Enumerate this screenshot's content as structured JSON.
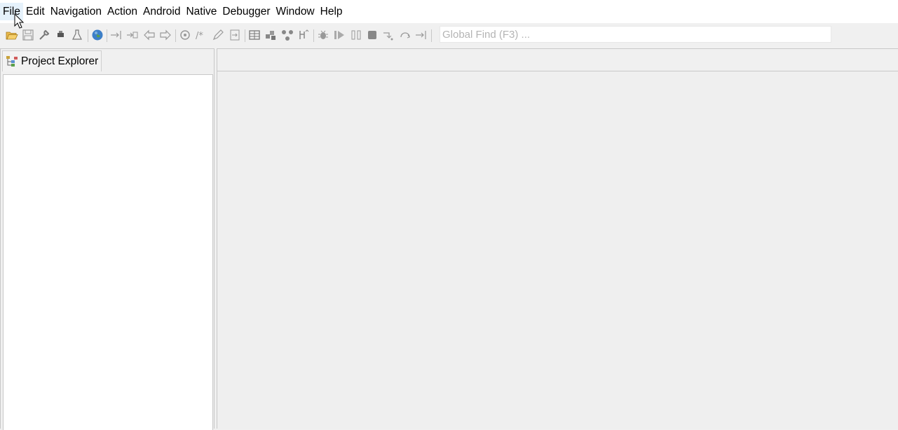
{
  "menubar": {
    "items": [
      {
        "label": "File"
      },
      {
        "label": "Edit"
      },
      {
        "label": "Navigation"
      },
      {
        "label": "Action"
      },
      {
        "label": "Android"
      },
      {
        "label": "Native"
      },
      {
        "label": "Debugger"
      },
      {
        "label": "Window"
      },
      {
        "label": "Help"
      }
    ]
  },
  "toolbar": {
    "global_find": {
      "placeholder": "Global Find (F3) ...",
      "value": ""
    },
    "icons": [
      "open-folder-icon",
      "save-icon",
      "wrench-icon",
      "stamp-icon",
      "flask-icon",
      "globe-icon",
      "step-in-icon",
      "step-into-icon",
      "back-arrow-icon",
      "forward-arrow-icon",
      "decompile-icon",
      "comment-icon",
      "pencil-icon",
      "jump-icon",
      "table-icon",
      "blocks-icon",
      "graph-icon",
      "hierarchy-icon",
      "debug-bug-icon",
      "run-icon",
      "pause-icon",
      "stop-icon",
      "step-over-icon",
      "step-return-icon",
      "run-to-line-icon"
    ]
  },
  "left_panel": {
    "tab_label": "Project Explorer"
  },
  "colors": {
    "background": "#f0f0f0",
    "menubar": "#ffffff",
    "active_menu": "#e5f1fb",
    "border": "#c8c8c8"
  }
}
